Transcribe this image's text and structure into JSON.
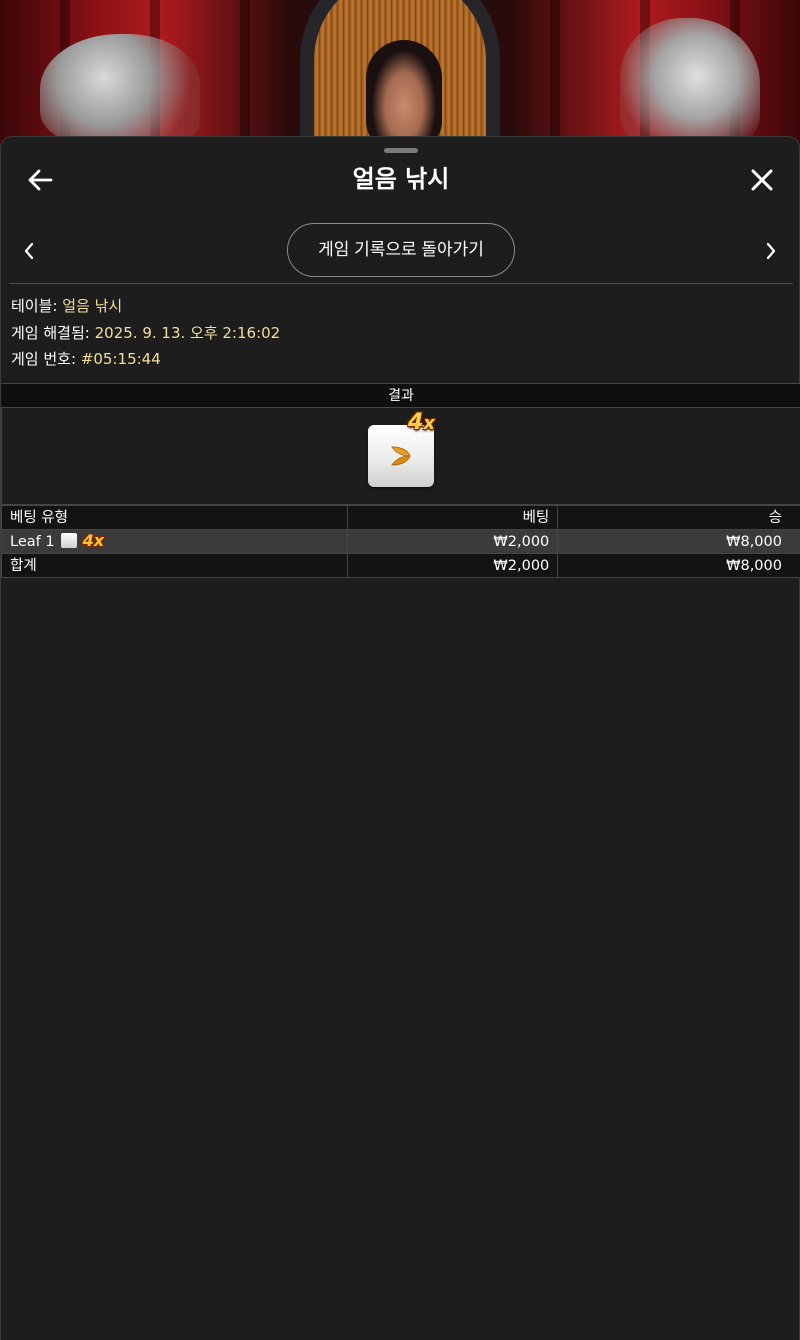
{
  "header": {
    "title": "얼음 낚시"
  },
  "nav": {
    "history_button": "게임 기록으로 돌아가기"
  },
  "info": {
    "table_label": "테이블:",
    "table_value": "얼음 낚시",
    "resolved_label": "게임 해결됨:",
    "resolved_value": "2025. 9. 13. 오후 2:16:02",
    "game_no_label": "게임 번호:",
    "game_no_value": "#05:15:44"
  },
  "result": {
    "header": "결과",
    "tile_icon": "leaf-icon",
    "multiplier_number": "4",
    "multiplier_x": "x"
  },
  "bets_table": {
    "columns": [
      "베팅 유형",
      "베팅",
      "승"
    ],
    "rows": [
      {
        "type": "Leaf 1",
        "multiplier_number": "4",
        "multiplier_x": "x",
        "bet": "₩2,000",
        "win": "₩8,000"
      }
    ],
    "total": {
      "label": "합계",
      "bet": "₩2,000",
      "win": "₩8,000"
    }
  },
  "colors": {
    "sheet_bg": "#1d1d1e",
    "info_value": "#f4df9a",
    "multiplier": "#ffd24a",
    "selected_row": "#3b3b3c"
  }
}
